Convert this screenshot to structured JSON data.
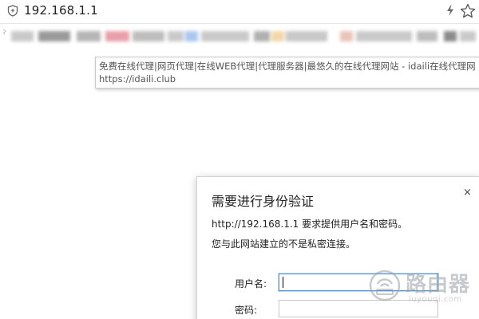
{
  "address_bar": {
    "url": "192.168.1.1",
    "icons": [
      "shield-icon",
      "bolt-icon",
      "star-icon"
    ]
  },
  "bookmarks_bar": {
    "note_mark": "ˀ",
    "colors": [
      "#9a9a9a",
      "#b5b5b5",
      "#e8a0a8",
      "#bdbdbd",
      "#a9c7f0",
      "#c9c9c9",
      "#f2d8a8",
      "#b0b0b0",
      "#e9c4b8",
      "#c8c8c8",
      "#8a8a8a"
    ]
  },
  "tooltip": {
    "title": "免费在线代理|网页代理|在线WEB代理|代理服务器|最悠久的在线代理网站 - idaili在线代理网",
    "url": "https://idaili.club"
  },
  "auth_dialog": {
    "title": "需要进行身份验证",
    "message1": "http://192.168.1.1 要求提供用户名和密码。",
    "message2": "您与此网站建立的不是私密连接。",
    "username_label": "用户名:",
    "password_label": "密码:",
    "username_value": "",
    "password_value": "",
    "close_glyph": "×"
  },
  "watermark": {
    "text": "路由器",
    "subtext": "luyouqi.com"
  }
}
